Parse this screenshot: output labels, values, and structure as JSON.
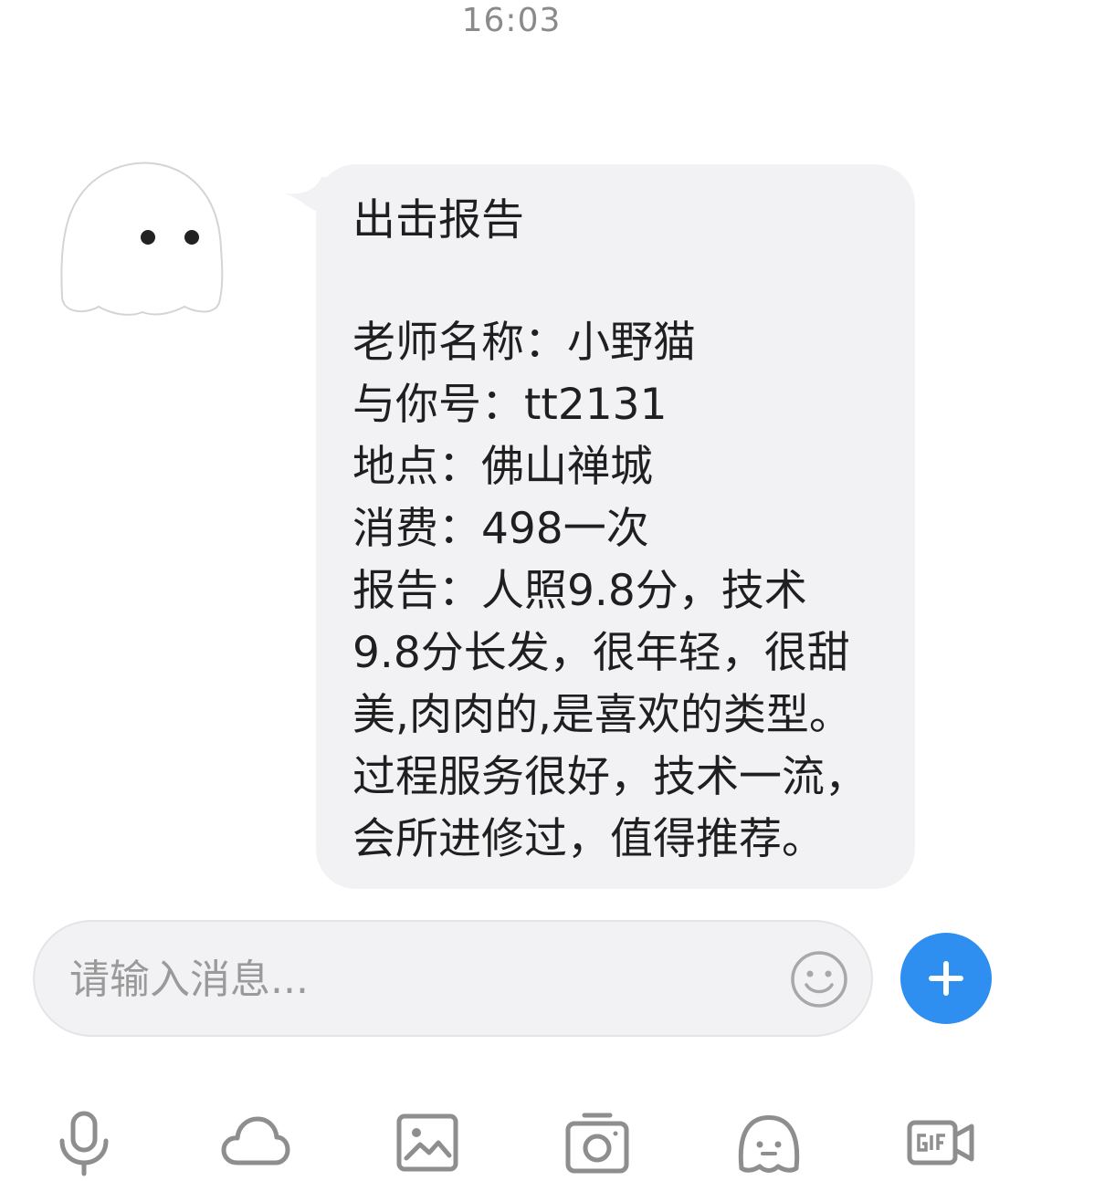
{
  "header": {
    "timestamp": "16:03"
  },
  "message": {
    "title": "出击报告",
    "lines": [
      "老师名称：小野猫",
      "与你号：tt2131",
      "地点：佛山禅城",
      "消费：498一次",
      "报告：人照9.8分，技术",
      "9.8分长发，很年轻，很甜",
      "美,肉肉的,是喜欢的类型。",
      "过程服务很好，技术一流，",
      "会所进修过，值得推荐。"
    ]
  },
  "composer": {
    "placeholder": "请输入消息...",
    "value": ""
  },
  "toolbar": {
    "items": [
      {
        "icon": "microphone-icon"
      },
      {
        "icon": "cloud-icon"
      },
      {
        "icon": "image-icon"
      },
      {
        "icon": "camera-icon"
      },
      {
        "icon": "ghost-emoji-icon"
      },
      {
        "icon": "gif-icon"
      }
    ]
  },
  "colors": {
    "accent": "#2f8ff0",
    "bubble_bg": "#f2f2f4",
    "icon_gray": "#8e8e8e",
    "timestamp_gray": "#8a8a8a"
  }
}
